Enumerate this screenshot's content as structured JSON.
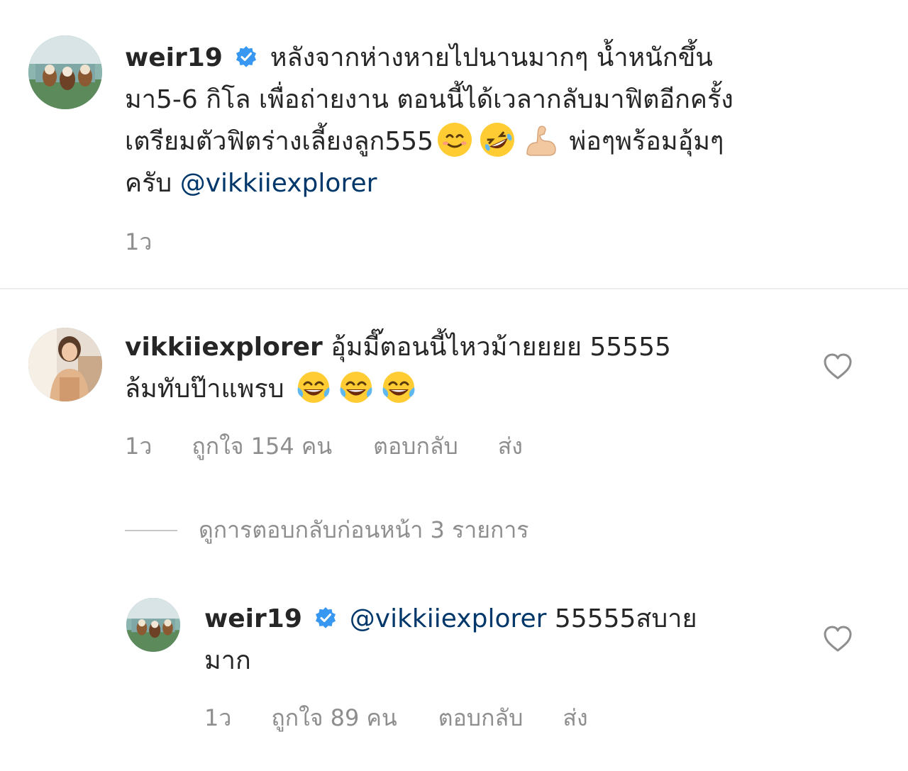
{
  "comments": [
    {
      "username": "weir19",
      "verified": true,
      "avatar_icon": "dogs-avatar-icon",
      "lines": [
        "หลังจากห่างหายไปนานมากๆ น้ำหนักขึ้น",
        "มา5-6 กิโล เพื่อถ่ายงาน ตอนนี้ได้เวลากลับมาฟิตอีกครั้ง",
        "เตรียมตัวฟิตร่างเลี้ยงลูก555",
        "พ่อๆพร้อมอุ้มๆ",
        "ครับ"
      ],
      "mention": "@vikkiiexplorer",
      "emojis": [
        "smiling-face-emoji",
        "rofl-emoji",
        "flexed-biceps-emoji"
      ],
      "time": "1ว"
    },
    {
      "username": "vikkiiexplorer",
      "verified": false,
      "avatar_icon": "woman-avatar-icon",
      "lines": [
        "อุ้มมี๊ตอนนี้ไหวม้ายยยย 55555",
        "ล้มทับป๊าแพรบ"
      ],
      "emojis": [
        "tears-of-joy-emoji",
        "tears-of-joy-emoji",
        "tears-of-joy-emoji"
      ],
      "time": "1ว",
      "likes": "ถูกใจ 154 คน",
      "reply": "ตอบกลับ",
      "send": "ส่ง"
    },
    {
      "username": "weir19",
      "verified": true,
      "avatar_icon": "dogs-avatar-icon",
      "mention": "@vikkiiexplorer",
      "lines": [
        "55555สบาย",
        "มาก"
      ],
      "time": "1ว",
      "likes": "ถูกใจ 89 คน",
      "reply": "ตอบกลับ",
      "send": "ส่ง"
    }
  ],
  "view_previous_replies": "ดูการตอบกลับก่อนหน้า 3 รายการ",
  "colors": {
    "text": "#262626",
    "meta": "#8e8e8e",
    "mention": "#00376b",
    "verified": "#3897f0",
    "divider": "#ececec"
  }
}
